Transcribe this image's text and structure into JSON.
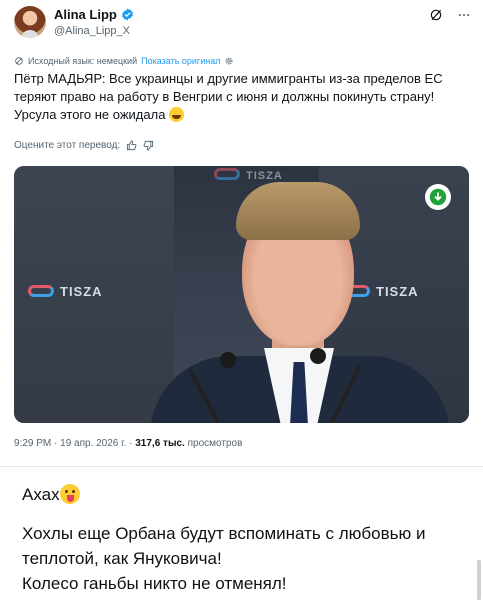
{
  "tweet": {
    "display_name": "Alina Lipp",
    "handle": "@Alina_Lipp_X",
    "source_language_note": "Исходный язык: немецкий",
    "show_original_label": "Показать оригинал",
    "text": "Пётр МАДЬЯР: Все украинцы и другие иммигранты из-за пределов ЕС теряют право на работу в Венгрии с июня и должны покинуть страну! Урсула этого не ожидала",
    "rate_translation_label": "Оцените этот перевод:",
    "timestamp": "9:29 PM · 19 апр. 2026 г. · ",
    "views_count": "317,6 тыс.",
    "views_label": " просмотров",
    "media": {
      "brand_left": "TISZA",
      "brand_right": "TISZA",
      "brand_top": "TISZA"
    }
  },
  "comment": {
    "line1": "Ахах",
    "line2": "Хохлы еще Орбана будут вспоминать с любовью и",
    "line3": "теплотой, как Януковича!",
    "line4": "Колесо ганьбы никто не отменял!"
  },
  "colors": {
    "link": "#1d9bf0",
    "verified": "#1d9bf0",
    "secondary_text": "#536471",
    "download_badge": "#22a33a"
  },
  "icons": [
    "verified-badge-icon",
    "grok-icon",
    "more-icon",
    "translate-icon",
    "settings-icon",
    "thumbs-up-icon",
    "thumbs-down-icon",
    "download-icon",
    "grinning-emoji",
    "tongue-emoji"
  ]
}
